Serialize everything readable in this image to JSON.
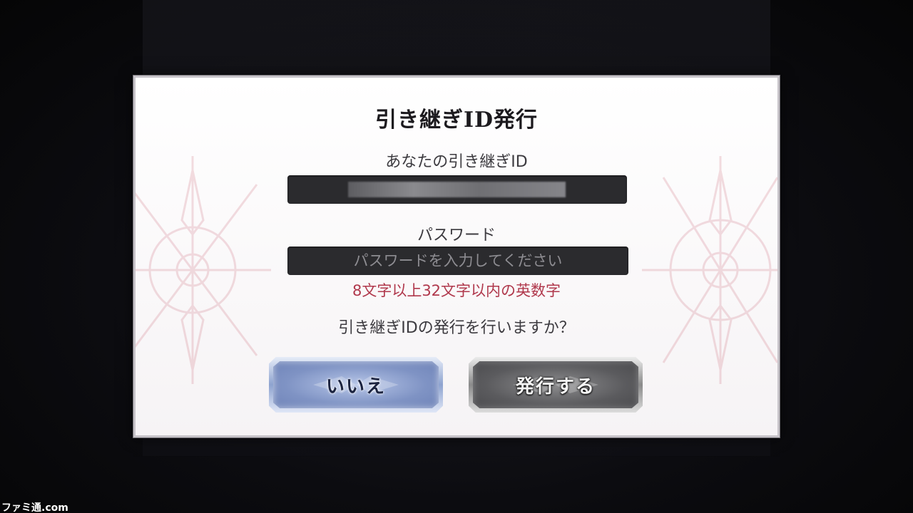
{
  "dialog": {
    "title": "引き継ぎID発行",
    "id_label": "あなたの引き継ぎID",
    "password_label": "パスワード",
    "password_placeholder": "パスワードを入力してください",
    "password_value": "",
    "hint": "8文字以上32文字以内の英数字",
    "question": "引き継ぎIDの発行を行いますか？",
    "buttons": {
      "no_label": "いいえ",
      "yes_label": "発行する"
    }
  },
  "watermark": "ファミ通.com",
  "colors": {
    "hint": "#b0384c",
    "title": "#1c1a1e",
    "input_bg": "#2b2b2e",
    "no_button": "#8ea3cf",
    "yes_button": "#5b5b5e"
  }
}
